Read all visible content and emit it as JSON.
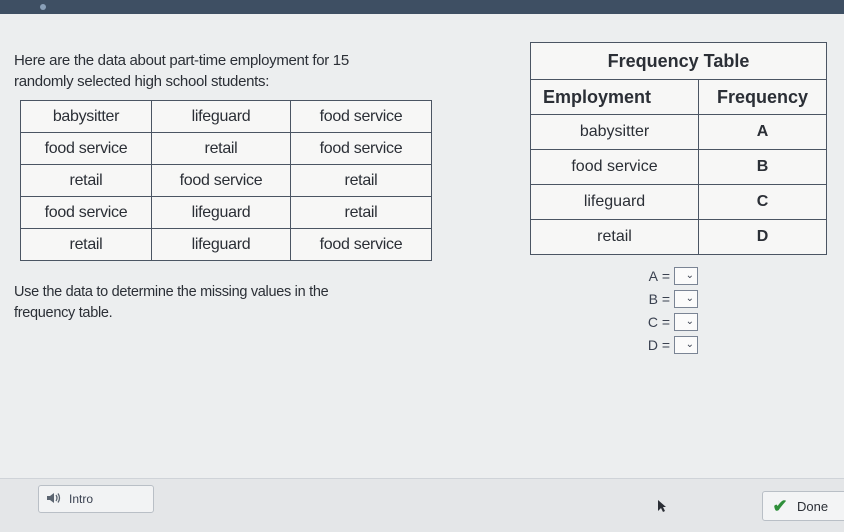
{
  "question": {
    "intro_line1": "Here are the data about part-time employment for 15",
    "intro_line2": "randomly selected high school students:",
    "instruction_line1": "Use the data to determine the missing values in the",
    "instruction_line2": "frequency table."
  },
  "data_table": {
    "rows": [
      [
        "babysitter",
        "lifeguard",
        "food service"
      ],
      [
        "food service",
        "retail",
        "food service"
      ],
      [
        "retail",
        "food service",
        "retail"
      ],
      [
        "food service",
        "lifeguard",
        "retail"
      ],
      [
        "retail",
        "lifeguard",
        "food service"
      ]
    ]
  },
  "frequency_table": {
    "title": "Frequency Table",
    "headers": [
      "Employment",
      "Frequency"
    ],
    "rows": [
      {
        "employment": "babysitter",
        "frequency": "A"
      },
      {
        "employment": "food service",
        "frequency": "B"
      },
      {
        "employment": "lifeguard",
        "frequency": "C"
      },
      {
        "employment": "retail",
        "frequency": "D"
      }
    ]
  },
  "answers": [
    {
      "label": "A",
      "eq": "=",
      "value": ""
    },
    {
      "label": "B",
      "eq": "=",
      "value": ""
    },
    {
      "label": "C",
      "eq": "=",
      "value": ""
    },
    {
      "label": "D",
      "eq": "=",
      "value": ""
    }
  ],
  "footer": {
    "intro_label": "Intro",
    "done_label": "Done"
  },
  "icons": {
    "speaker": "speaker-icon",
    "check": "checkmark-icon",
    "caret": "chevron-down-icon"
  },
  "colors": {
    "check": "#2f8f3a",
    "topbar": "#3e4f63"
  }
}
